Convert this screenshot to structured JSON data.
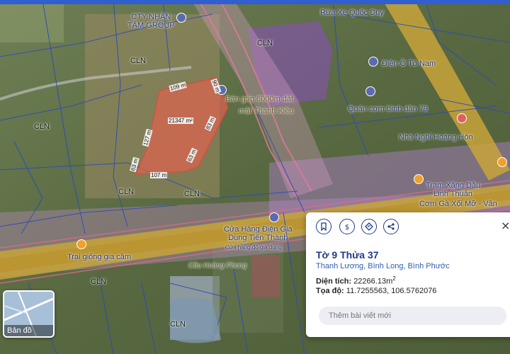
{
  "map_labels": {
    "cln_1": "CLN",
    "cln_2": "CLN",
    "cln_3": "CLN",
    "cln_4": "CLN",
    "cln_5": "CLN",
    "cln_6": "CLN",
    "cln_7": "CLN",
    "company": "CTY NHÂN\nTÂM GROUP",
    "car_wash": "Rửa Xe Quốc Duy",
    "electric": "Điện Ô Tô Nam",
    "restaurant": "Quán cơm bình dân 79",
    "hotel": "Nhà Nghỉ Hoàng Hôn",
    "gas_station": "Trạm Xăng Dầu\nLinh Thuận",
    "chicken_rice": "Cơm Gà Xối Mỡ - Vân",
    "appliance_store": "Cửa Hàng Điện Gia\nDụng Tiến Thành",
    "appliance_sub": "Cửa hàng đồ gia dụng",
    "poultry": "Trại giống gia cầm",
    "road_name": "Cầu Hoàng Phong",
    "sale_text": "Bán gấp 6000m đất",
    "sale_text2": "mặt Thành Kiều"
  },
  "parcel_measurements": {
    "area": "21347 m²",
    "top": "109 m",
    "top_right": "90 m",
    "right": "83 m",
    "bottom": "107 m",
    "left_a": "127 m",
    "left_b": "63 m",
    "inner": "63 m"
  },
  "basemap": {
    "label": "Bản đồ"
  },
  "panel": {
    "title": "Tờ 9 Thửa 37",
    "location": "Thanh Lương, Bình Long, Bình Phước",
    "area_label": "Diện tích:",
    "area_value": "22266.13m",
    "area_sup": "2",
    "coord_label": "Tọa độ:",
    "coord_value": "11.7255563, 106.5762076",
    "post_placeholder": "Thêm bài viết mới",
    "close": "×"
  },
  "icons": {
    "bookmark": "bookmark-icon",
    "price": "dollar-icon",
    "directions": "directions-icon",
    "share": "share-icon"
  }
}
